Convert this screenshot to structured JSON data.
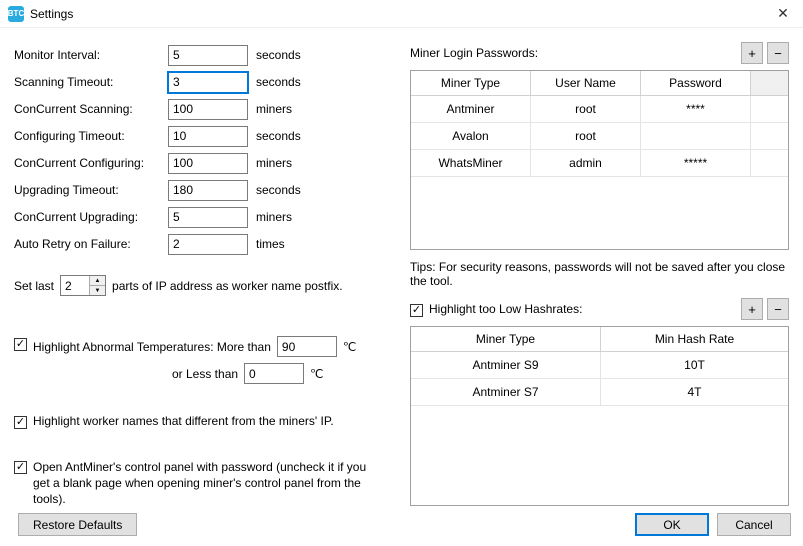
{
  "window": {
    "title": "Settings"
  },
  "left": {
    "fields": [
      {
        "label": "Monitor Interval:",
        "value": "5",
        "unit": "seconds"
      },
      {
        "label": "Scanning Timeout:",
        "value": "3",
        "unit": "seconds"
      },
      {
        "label": "ConCurrent Scanning:",
        "value": "100",
        "unit": "miners"
      },
      {
        "label": "Configuring Timeout:",
        "value": "10",
        "unit": "seconds"
      },
      {
        "label": "ConCurrent Configuring:",
        "value": "100",
        "unit": "miners"
      },
      {
        "label": "Upgrading Timeout:",
        "value": "180",
        "unit": "seconds"
      },
      {
        "label": "ConCurrent Upgrading:",
        "value": "5",
        "unit": "miners"
      },
      {
        "label": "Auto Retry on Failure:",
        "value": "2",
        "unit": "times"
      }
    ],
    "setlast_prefix": "Set last",
    "setlast_value": "2",
    "setlast_suffix": "parts of IP address as worker name postfix.",
    "hl_temp_label": "Highlight Abnormal Temperatures: More than",
    "hl_temp_hi": "90",
    "hl_temp_lo_label": "or Less than",
    "hl_temp_lo": "0",
    "deg_c": "℃",
    "hl_worker": "Highlight worker names that different from the miners' IP.",
    "open_panel": "Open AntMiner's control panel with password (uncheck it if you get a blank page when opening miner's control panel from the tools)."
  },
  "right": {
    "login_label": "Miner Login Passwords:",
    "login_headers": [
      "Miner Type",
      "User Name",
      "Password"
    ],
    "login_rows": [
      {
        "type": "Antminer",
        "user": "root",
        "pass": "****"
      },
      {
        "type": "Avalon",
        "user": "root",
        "pass": ""
      },
      {
        "type": "WhatsMiner",
        "user": "admin",
        "pass": "*****"
      }
    ],
    "tips": "Tips: For security reasons, passwords will not be saved after you close the tool.",
    "hl_low_label": "Highlight too Low Hashrates:",
    "hash_headers": [
      "Miner Type",
      "Min Hash Rate"
    ],
    "hash_rows": [
      {
        "type": "Antminer S9",
        "rate": "10T"
      },
      {
        "type": "Antminer S7",
        "rate": "4T"
      }
    ]
  },
  "buttons": {
    "plus": "+",
    "minus": "−",
    "restore": "Restore Defaults",
    "ok": "OK",
    "cancel": "Cancel"
  }
}
